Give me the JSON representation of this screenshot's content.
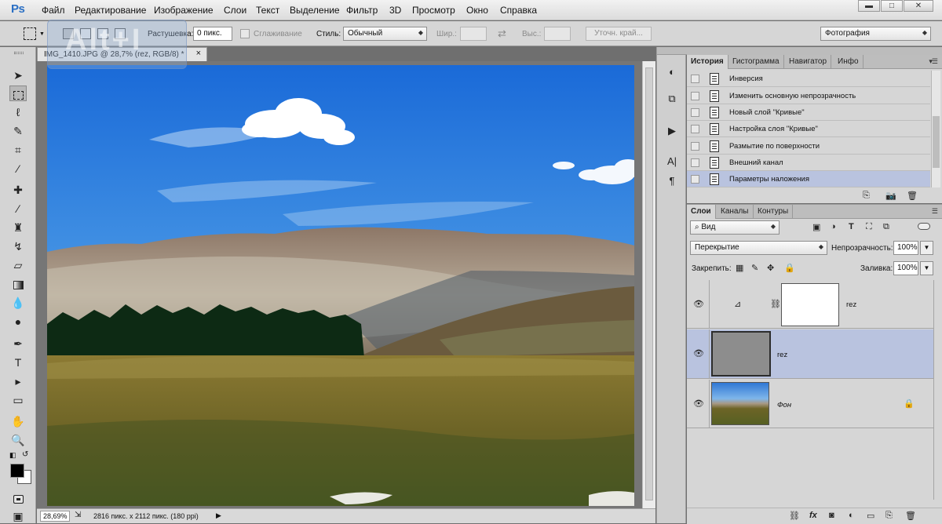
{
  "app": {
    "logo": "Ps"
  },
  "menu": [
    "Файл",
    "Редактирование",
    "Изображение",
    "Слои",
    "Текст",
    "Выделение",
    "Фильтр",
    "3D",
    "Просмотр",
    "Окно",
    "Справка"
  ],
  "window_controls": {
    "minimize": "▬",
    "maximize": "□",
    "close": "✕"
  },
  "options": {
    "feather_label": "Растушевка:",
    "feather_value": "0 пикс.",
    "antialias_label": "Сглаживание",
    "style_label": "Стиль:",
    "style_value": "Обычный",
    "width_label": "Шир.:",
    "height_label": "Выс.:",
    "refine_label": "Уточн. край...",
    "workspace_value": "Фотография"
  },
  "overlay_hint": "Alt+I",
  "document": {
    "tab_title": "IMG_1410.JPG @ 28,7% (rez, RGB/8) *",
    "close": "×",
    "zoom": "28,69%",
    "info": "2816 пикс. x 2112 пикс. (180 ppi)"
  },
  "history_panel": {
    "tabs": [
      "История",
      "Гистограмма",
      "Навигатор",
      "Инфо"
    ],
    "items": [
      "Инверсия",
      "Изменить основную непрозрачность",
      "Новый слой \"Кривые\"",
      "Настройка слоя \"Кривые\"",
      "Размытие по поверхности",
      "Внешний канал",
      "Параметры наложения"
    ],
    "selected_index": 6
  },
  "layers_panel": {
    "tabs": [
      "Слои",
      "Каналы",
      "Контуры"
    ],
    "filter_value": "Вид",
    "blend_mode": "Перекрытие",
    "opacity_label": "Непрозрачность:",
    "opacity_value": "100%",
    "lock_label": "Закрепить:",
    "fill_label": "Заливка:",
    "fill_value": "100%",
    "layers": [
      {
        "name": "rez",
        "type": "curves-adjustment"
      },
      {
        "name": "rez",
        "type": "pixel",
        "selected": true
      },
      {
        "name": "Фон",
        "type": "background",
        "locked": true
      }
    ]
  },
  "colors": {
    "accent_selected": "#b9c3df",
    "ps_blue": "#2a6fc4"
  }
}
